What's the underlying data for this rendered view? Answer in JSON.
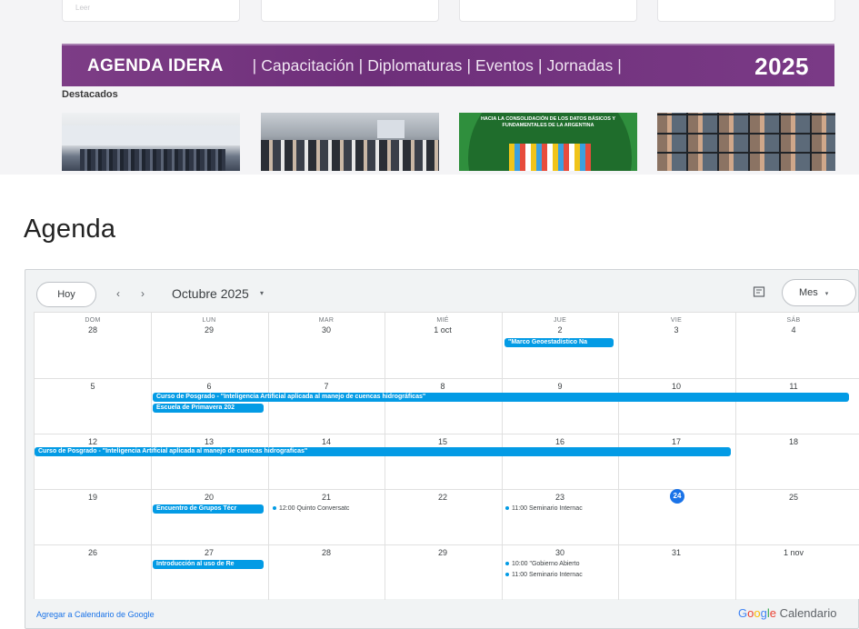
{
  "top_cards": [
    "Leer"
  ],
  "banner": {
    "title": "AGENDA IDERA",
    "categories": "| Capacitación | Diplomaturas | Eventos | Jornadas |",
    "year": "2025"
  },
  "destacados_label": "Destacados",
  "thumbnail_caption": "HACIA LA CONSOLIDACIÓN DE LOS DATOS BÁSICOS Y FUNDAMENTALES DE LA ARGENTINA",
  "agenda_title": "Agenda",
  "calendar": {
    "today_button": "Hoy",
    "prev": "‹",
    "next": "›",
    "month": "Octubre 2025",
    "month_dropdown": "▾",
    "view_button": "Mes",
    "view_dropdown": "▾",
    "weekdays": [
      "DOM",
      "LUN",
      "MAR",
      "MIÉ",
      "JUE",
      "VIE",
      "SÁB"
    ],
    "weeks": [
      [
        "28",
        "29",
        "30",
        "1 oct",
        "2",
        "3",
        "4"
      ],
      [
        "5",
        "6",
        "7",
        "8",
        "9",
        "10",
        "11"
      ],
      [
        "12",
        "13",
        "14",
        "15",
        "16",
        "17",
        "18"
      ],
      [
        "19",
        "20",
        "21",
        "22",
        "23",
        "24",
        "25"
      ],
      [
        "26",
        "27",
        "28",
        "29",
        "30",
        "31",
        "1 nov"
      ]
    ],
    "today": "24",
    "events": {
      "marco": "\"Marco Geoestadístico Na",
      "curso_w2": "Curso de Posgrado - \"Inteligencia Artificial aplicada al manejo de cuencas hidrográficas\"",
      "escuela": "Escuela de Primavera 202",
      "curso_w3": "Curso de Posgrado - \"Inteligencia Artificial aplicada al manejo de cuencas hidrograficas\"",
      "encuentro": "Encuentro de Grupos Técr",
      "quinto": "12:00 Quinto Conversatc",
      "seminario_23": "11:00 Seminario Internac",
      "introduccion": "Introducción al uso de Re",
      "gobierno": "10:00 \"Gobierno Abierto",
      "seminario_30": "11:00 Seminario Internac"
    },
    "footer_link": "Agregar a Calendario de Google",
    "brand": {
      "g1": "G",
      "g2": "o",
      "g3": "o",
      "g4": "g",
      "g5": "l",
      "g6": "e",
      "rest": " Calendario"
    },
    "colors": {
      "event": "#039be5",
      "today": "#1a73e8",
      "banner": "#7d3d86"
    }
  }
}
